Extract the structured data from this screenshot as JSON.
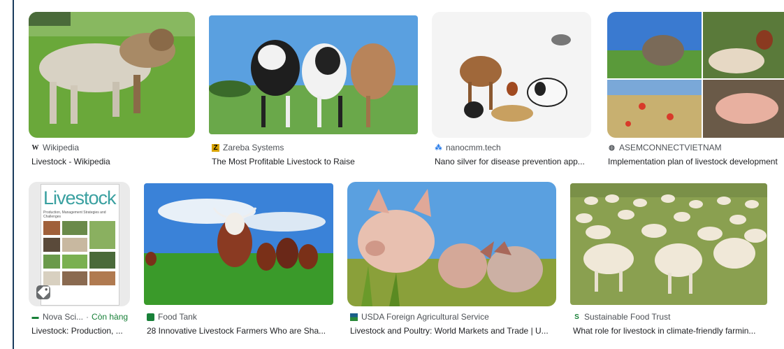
{
  "results": [
    {
      "source": "Wikipedia",
      "title": "Livestock - Wikipedia",
      "favicon": "wikipedia-icon"
    },
    {
      "source": "Zareba Systems",
      "title": "The Most Profitable Livestock to Raise",
      "favicon": "zareba-icon"
    },
    {
      "source": "nanocmm.tech",
      "title": "Nano silver for disease prevention app...",
      "favicon": "nanocmm-icon"
    },
    {
      "source": "ASEMCONNECTVIETNAM",
      "title": "Implementation plan of livestock development",
      "favicon": "globe-icon"
    },
    {
      "source": "Nova Sci...",
      "stock": "Còn hàng",
      "title": "Livestock: Production, ...",
      "favicon": "nova-icon",
      "book_title": "Livestock",
      "book_subtitle": "Production, Management Strategies and Challenges"
    },
    {
      "source": "Food Tank",
      "title": "28 Innovative Livestock Farmers Who are Sha...",
      "favicon": "foodtank-icon"
    },
    {
      "source": "USDA Foreign Agricultural Service",
      "title": "Livestock and Poultry: World Markets and Trade | U...",
      "favicon": "usda-icon"
    },
    {
      "source": "Sustainable Food Trust",
      "title": "What role for livestock in climate-friendly farmin...",
      "favicon": "sft-icon"
    }
  ],
  "colors": {
    "accent": "#1a3b5d",
    "sky": "#4a90d9",
    "grass": "#5a9a2e"
  }
}
